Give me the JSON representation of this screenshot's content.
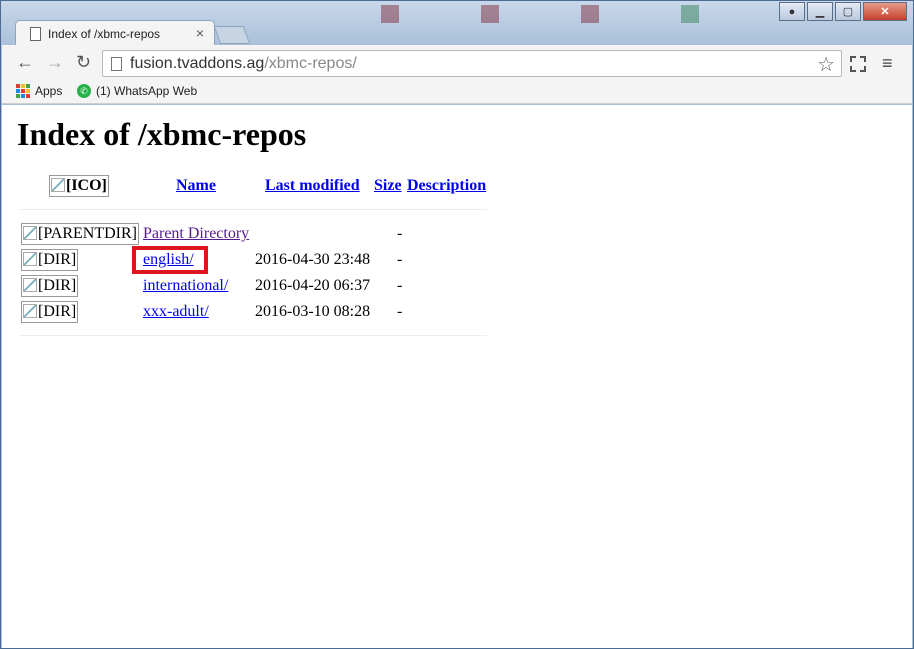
{
  "browser": {
    "tab_title": "Index of /xbmc-repos",
    "url_host": "fusion.tvaddons.ag",
    "url_path": "/xbmc-repos/",
    "bookmarks": [
      {
        "label": "Apps",
        "icon": "apps-grid-icon"
      },
      {
        "label": "(1) WhatsApp Web",
        "icon": "whatsapp-icon"
      }
    ],
    "icons": {
      "back": "←",
      "forward": "→",
      "reload": "↻",
      "star": "☆",
      "menu": "≡",
      "close_tab": "×"
    }
  },
  "page": {
    "heading": "Index of /xbmc-repos",
    "columns": {
      "icon": "[ICO]",
      "name": "Name",
      "last_modified": "Last modified",
      "size": "Size",
      "description": "Description"
    },
    "rows": [
      {
        "icon_alt": "[PARENTDIR]",
        "name": "Parent Directory",
        "modified": "",
        "size": "-"
      },
      {
        "icon_alt": "[DIR]",
        "name": "english/",
        "modified": "2016-04-30 23:48",
        "size": "-"
      },
      {
        "icon_alt": "[DIR]",
        "name": "international/",
        "modified": "2016-04-20 06:37",
        "size": "-"
      },
      {
        "icon_alt": "[DIR]",
        "name": "xxx-adult/",
        "modified": "2016-03-10 08:28",
        "size": "-"
      }
    ],
    "highlighted_row": "english/"
  },
  "colors": {
    "link": "#0000ee",
    "visited_link": "#551a8b",
    "highlight_box": "#e0141e"
  }
}
